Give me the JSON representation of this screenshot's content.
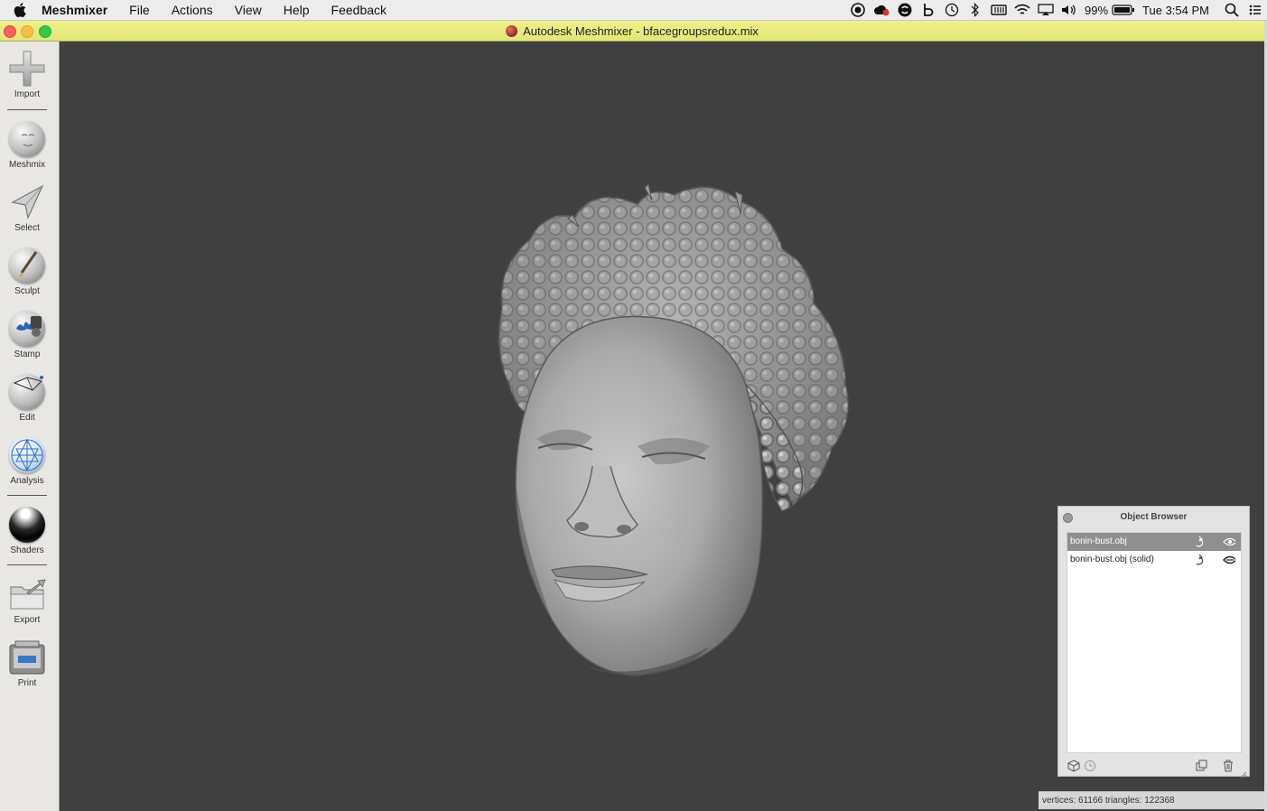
{
  "menubar": {
    "app_name": "Meshmixer",
    "menus": [
      "File",
      "Actions",
      "View",
      "Help",
      "Feedback"
    ],
    "battery": "99%",
    "clock": "Tue 3:54 PM"
  },
  "window": {
    "title": "Autodesk Meshmixer - bfacegroupsredux.mix"
  },
  "toolbar": {
    "items": [
      {
        "label": "Import",
        "icon": "plus-icon"
      },
      {
        "label": "Meshmix",
        "icon": "meshmix-sphere-icon"
      },
      {
        "label": "Select",
        "icon": "select-arrow-icon"
      },
      {
        "label": "Sculpt",
        "icon": "sculpt-brush-icon"
      },
      {
        "label": "Stamp",
        "icon": "stamp-icon"
      },
      {
        "label": "Edit",
        "icon": "edit-sphere-icon"
      },
      {
        "label": "Analysis",
        "icon": "analysis-sphere-icon"
      },
      {
        "label": "Shaders",
        "icon": "shader-sphere-icon"
      },
      {
        "label": "Export",
        "icon": "export-folder-icon"
      },
      {
        "label": "Print",
        "icon": "printer-icon"
      }
    ]
  },
  "object_browser": {
    "title": "Object Browser",
    "objects": [
      {
        "name": "bonin-bust.obj",
        "selected": true
      },
      {
        "name": "bonin-bust.obj (solid)",
        "selected": false
      }
    ]
  },
  "status": {
    "text": "vertices: 61166 triangles: 122368"
  },
  "colors": {
    "viewport_bg": "#404040",
    "titlebar": "#e9ec80",
    "selection": "#8f8f8f"
  }
}
